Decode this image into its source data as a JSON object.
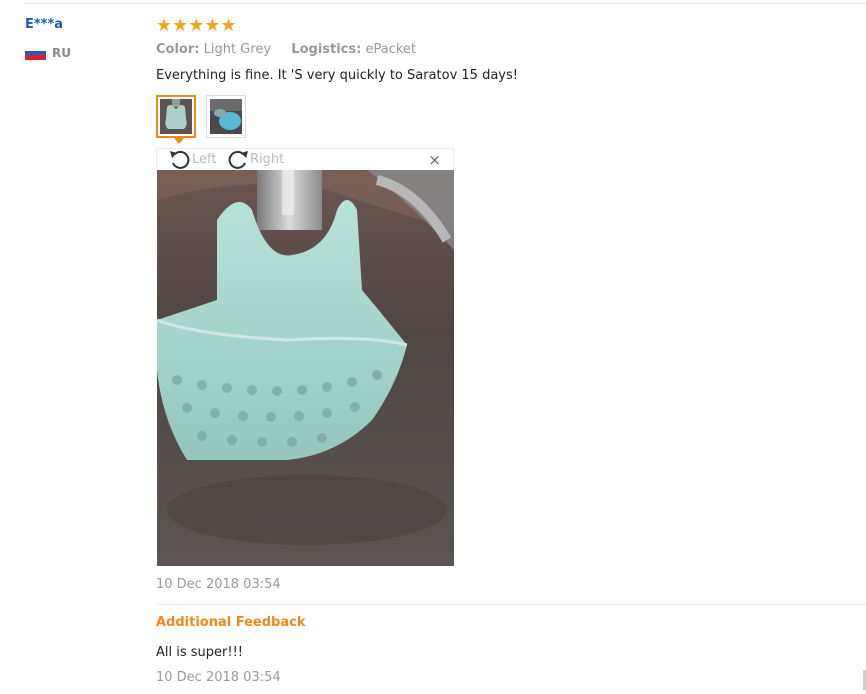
{
  "user": {
    "name": "E***a",
    "country": "RU",
    "flag_colors": [
      "#ffffff",
      "#2a55c8",
      "#d8222a"
    ]
  },
  "review": {
    "rating": 5,
    "stars": "★★★★★",
    "color_label": "Color:",
    "color_value": "Light Grey",
    "logistics_label": "Logistics:",
    "logistics_value": "ePacket",
    "text": "Everything is fine. It 'S very quickly to Saratov 15 days!",
    "date": "10 Dec 2018 03:54"
  },
  "viewer": {
    "rotate_left_label": "Left",
    "rotate_right_label": "Right",
    "close_symbol": "×",
    "icons": [
      "rotate-left-icon",
      "rotate-right-icon",
      "close-icon"
    ]
  },
  "additional": {
    "title": "Additional Feedback",
    "text": "All is super!!!",
    "date": "10 Dec 2018 03:54"
  },
  "colors": {
    "accent": "#f08a1c",
    "star": "#f5a41f",
    "link": "#1a5db5",
    "muted": "#999999"
  }
}
